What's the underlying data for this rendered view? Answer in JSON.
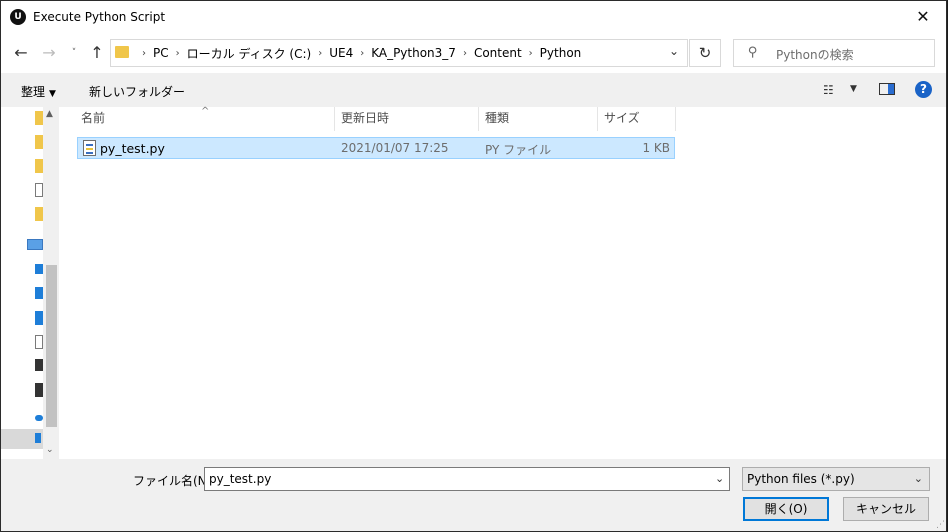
{
  "window": {
    "title": "Execute Python Script",
    "app_icon": "U"
  },
  "nav": {
    "back": "←",
    "forward": "→",
    "recent": "˅",
    "up": "↑",
    "breadcrumbs": [
      "PC",
      "ローカル ディスク (C:)",
      "UE4",
      "KA_Python3_7",
      "Content",
      "Python"
    ],
    "refresh": "↻"
  },
  "search": {
    "placeholder": "Pythonの検索"
  },
  "commandbar": {
    "organize": "整理",
    "new_folder": "新しいフォルダー"
  },
  "columns": {
    "name": "名前",
    "date": "更新日時",
    "type": "種類",
    "size": "サイズ"
  },
  "files": [
    {
      "name": "py_test.py",
      "date": "2021/01/07 17:25",
      "type": "PY ファイル",
      "size": "1 KB"
    }
  ],
  "bottom": {
    "filename_label": "ファイル名(N):",
    "filename_value": "py_test.py",
    "filter": "Python files (*.py)",
    "open": "開く(O)",
    "cancel": "キャンセル"
  },
  "colors": {
    "accent": "#0078d7",
    "selection": "#cce8ff",
    "folder": "#f0c64a"
  }
}
